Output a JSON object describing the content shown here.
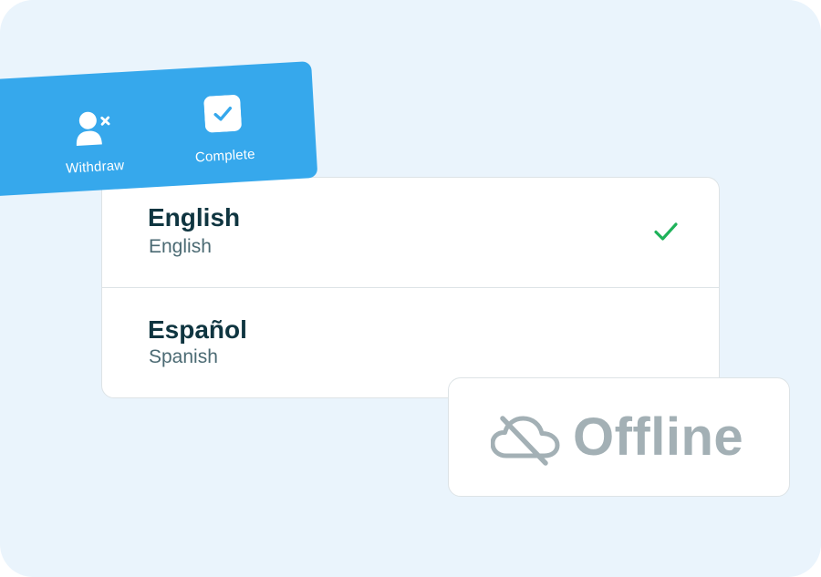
{
  "actions": {
    "withdraw": {
      "label": "Withdraw",
      "icon": "user-remove-icon"
    },
    "complete": {
      "label": "Complete",
      "icon": "checkbox-checked-icon"
    }
  },
  "languages": [
    {
      "native": "English",
      "english": "English",
      "selected": true
    },
    {
      "native": "Español",
      "english": "Spanish",
      "selected": false
    }
  ],
  "status": {
    "label": "Offline",
    "icon": "cloud-off-icon"
  },
  "colors": {
    "background": "#eaf4fc",
    "accent": "#36a8ec",
    "check": "#1fb25a",
    "text_primary": "#0f3540",
    "text_secondary": "#4b6a73",
    "offline": "#a3b0b5"
  }
}
